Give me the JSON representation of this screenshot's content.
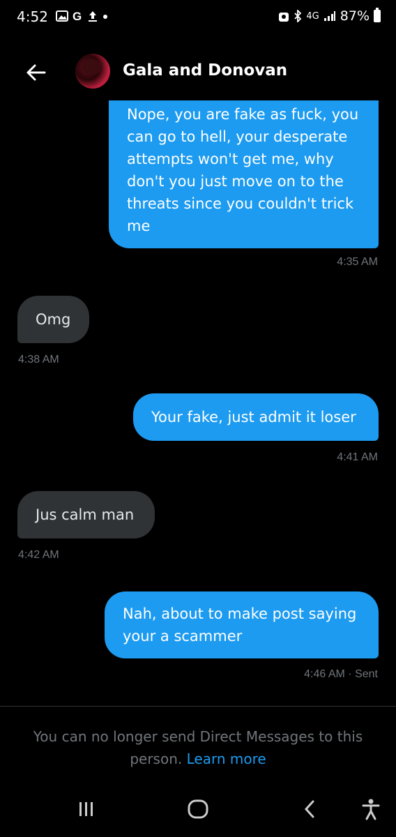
{
  "status_bar": {
    "time": "4:52",
    "network": "4G",
    "battery": "87%"
  },
  "header": {
    "title": "Gala and Donovan"
  },
  "messages": [
    {
      "direction": "out",
      "text": "Nope, you are fake as fuck, you can go to hell, your desperate attempts won't get me, why don't you just move on to the threats since you couldn't trick me",
      "time": "4:35 AM"
    },
    {
      "direction": "in",
      "text": "Omg",
      "time": "4:38 AM"
    },
    {
      "direction": "out",
      "text": "Your fake, just admit it loser",
      "time": "4:41 AM"
    },
    {
      "direction": "in",
      "text": "Jus calm man",
      "time": "4:42 AM"
    },
    {
      "direction": "out",
      "text": "Nah, about to make post saying your a scammer",
      "time": "4:46 AM · Sent"
    }
  ],
  "footer": {
    "notice": "You can no longer send Direct Messages to this person.",
    "learn_more": "Learn more"
  },
  "colors": {
    "accent": "#1d9bf0",
    "incoming_bubble": "#2f3336",
    "background": "#000000"
  }
}
